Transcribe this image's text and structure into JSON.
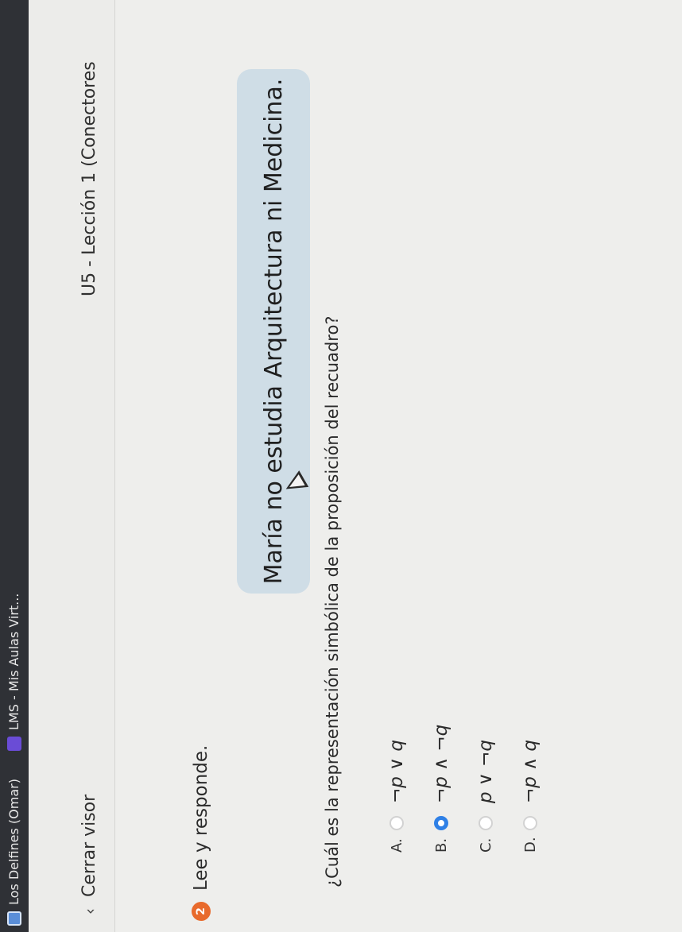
{
  "browser": {
    "tabs": [
      {
        "label": "Los Delfines (Omar)",
        "icon": "app-icon"
      },
      {
        "label": "LMS - Mis Aulas Virt...",
        "icon": "lms-icon"
      }
    ]
  },
  "header": {
    "close_label": "Cerrar visor",
    "lesson_title": "U5 - Lección 1 (Conectores"
  },
  "activity": {
    "step_number": "2",
    "instruction": "Lee y responde.",
    "statement": "María no estudia Arquitectura ni Medicina.",
    "question": "¿Cuál es la representación simbólica de la proposición del recuadro?",
    "options": [
      {
        "letter": "A.",
        "text": "¬p ∨ q",
        "selected": false
      },
      {
        "letter": "B.",
        "text": "¬p ∧ ¬q",
        "selected": true
      },
      {
        "letter": "C.",
        "text": "p ∨ ¬q",
        "selected": false
      },
      {
        "letter": "D.",
        "text": "¬p ∧ q",
        "selected": false
      }
    ]
  },
  "colors": {
    "step_badge": "#e86a2c",
    "selected_radio": "#2f80e6",
    "statement_bg": "#cfdde6"
  }
}
